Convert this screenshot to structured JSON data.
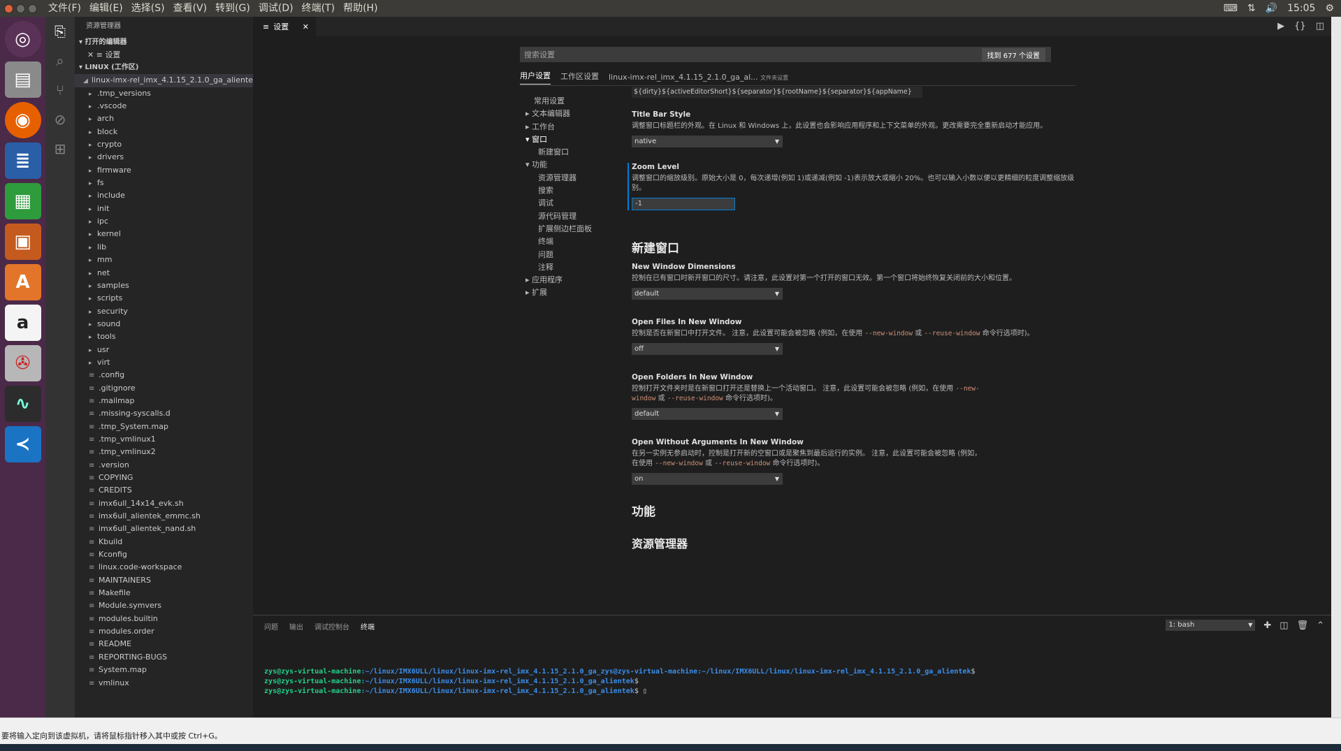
{
  "menubar": {
    "items": [
      "文件(F)",
      "编辑(E)",
      "选择(S)",
      "查看(V)",
      "转到(G)",
      "调试(D)",
      "终端(T)",
      "帮助(H)"
    ],
    "time": "15:05"
  },
  "sidebar": {
    "title": "资源管理器",
    "open_editors_header": "打开的编辑器",
    "open_editor_item": "设置",
    "workspace_header": "LINUX (工作区)",
    "root_folder": "linux-imx-rel_imx_4.1.15_2.1.0_ga_alientek",
    "folders": [
      ".tmp_versions",
      ".vscode",
      "arch",
      "block",
      "crypto",
      "drivers",
      "firmware",
      "fs",
      "include",
      "init",
      "ipc",
      "kernel",
      "lib",
      "mm",
      "net",
      "samples",
      "scripts",
      "security",
      "sound",
      "tools",
      "usr",
      "virt"
    ],
    "files": [
      ".config",
      ".gitignore",
      ".mailmap",
      ".missing-syscalls.d",
      ".tmp_System.map",
      ".tmp_vmlinux1",
      ".tmp_vmlinux2",
      ".version",
      "COPYING",
      "CREDITS",
      "imx6ull_14x14_evk.sh",
      "imx6ull_alientek_emmc.sh",
      "imx6ull_alientek_nand.sh",
      "Kbuild",
      "Kconfig",
      "linux.code-workspace",
      "MAINTAINERS",
      "Makefile",
      "Module.symvers",
      "modules.builtin",
      "modules.order",
      "README",
      "REPORTING-BUGS",
      "System.map",
      "vmlinux"
    ]
  },
  "editor": {
    "tab_label": "设置",
    "search_placeholder": "搜索设置",
    "search_count": "找到 677 个设置",
    "settings_tabs": [
      "用户设置",
      "工作区设置",
      "linux-imx-rel_imx_4.1.15_2.1.0_ga_al..."
    ],
    "folder_settings_label": "文件夹设置",
    "toc": [
      "常用设置",
      "文本编辑器",
      "工作台",
      "窗口",
      "新建窗口",
      "功能",
      "资源管理器",
      "搜索",
      "调试",
      "源代码管理",
      "扩展侧边栏面板",
      "终端",
      "问题",
      "注释",
      "应用程序",
      "扩展"
    ],
    "title_value": "${dirty}${activeEditorShort}${separator}${rootName}${separator}${appName}",
    "title_bar_style": {
      "title": "Title Bar Style",
      "desc": "调整窗口标题栏的外观。在 Linux 和 Windows 上，此设置也会影响应用程序和上下文菜单的外观。更改需要完全重新启动才能应用。",
      "value": "native"
    },
    "zoom_level": {
      "title": "Zoom Level",
      "desc": "调整窗口的缩放级别。原始大小是 0，每次递增(例如 1)或递减(例如 -1)表示放大或缩小 20%。也可以输入小数以便以更精细的粒度调整缩放级别。",
      "value": "-1"
    },
    "section_new_window": "新建窗口",
    "new_window_dimensions": {
      "title": "New Window Dimensions",
      "desc": "控制在已有窗口时新开窗口的尺寸。请注意，此设置对第一个打开的窗口无效。第一个窗口将始终恢复关闭前的大小和位置。",
      "value": "default"
    },
    "open_files_in_new_window": {
      "title": "Open Files In New Window",
      "desc_a": "控制是否在新窗口中打开文件。 注意，此设置可能会被忽略 (例如，在使用 ",
      "code1": "--new-window",
      "desc_b": " 或 ",
      "code2": "--reuse-window",
      "desc_c": " 命令行选项时)。",
      "value": "off"
    },
    "open_folders_in_new_window": {
      "title": "Open Folders In New Window",
      "desc_a": "控制打开文件夹时是在新窗口打开还是替换上一个活动窗口。 注意，此设置可能会被忽略 (例如，在使用 ",
      "code1": "--new-window",
      "desc_b": " 或 ",
      "code2": "--reuse-window",
      "desc_c": " 命令行选项时)。",
      "value": "default"
    },
    "open_without_arguments": {
      "title": "Open Without Arguments In New Window",
      "desc_a": "在另一实例无参启动时，控制是打开新的空窗口或是聚焦到最后运行的实例。 注意，此设置可能会被忽略 (例如，在使用 ",
      "code1": "--new-window",
      "desc_b": " 或 ",
      "code2": "--reuse-window",
      "desc_c": " 命令行选项时)。",
      "value": "on"
    },
    "section_features": "功能",
    "section_explorer": "资源管理器"
  },
  "panel": {
    "tabs": [
      "问题",
      "输出",
      "调试控制台",
      "终端"
    ],
    "terminal_select": "1: bash",
    "lines": [
      {
        "user": "zys@zys-virtual-machine",
        "path": ":~/linux/IMX6ULL/linux/linux-imx-rel_imx_4.1.15_2.1.0_ga_zys@zys-virtual-machine:~/linux/IMX6ULL/linux/linux-imx-rel_imx_4.1.15_2.1.0_ga_alientek",
        "tail": "$"
      },
      {
        "user": "zys@zys-virtual-machine",
        "path": ":~/linux/IMX6ULL/linux/linux-imx-rel_imx_4.1.15_2.1.0_ga_alientek",
        "tail": "$"
      },
      {
        "user": "zys@zys-virtual-machine",
        "path": ":~/linux/IMX6ULL/linux/linux-imx-rel_imx_4.1.15_2.1.0_ga_alientek",
        "tail": "$ ▯"
      }
    ]
  },
  "statusbar": {
    "text": "要将输入定向到该虚拟机，请将鼠标指针移入其中或按 Ctrl+G。"
  }
}
